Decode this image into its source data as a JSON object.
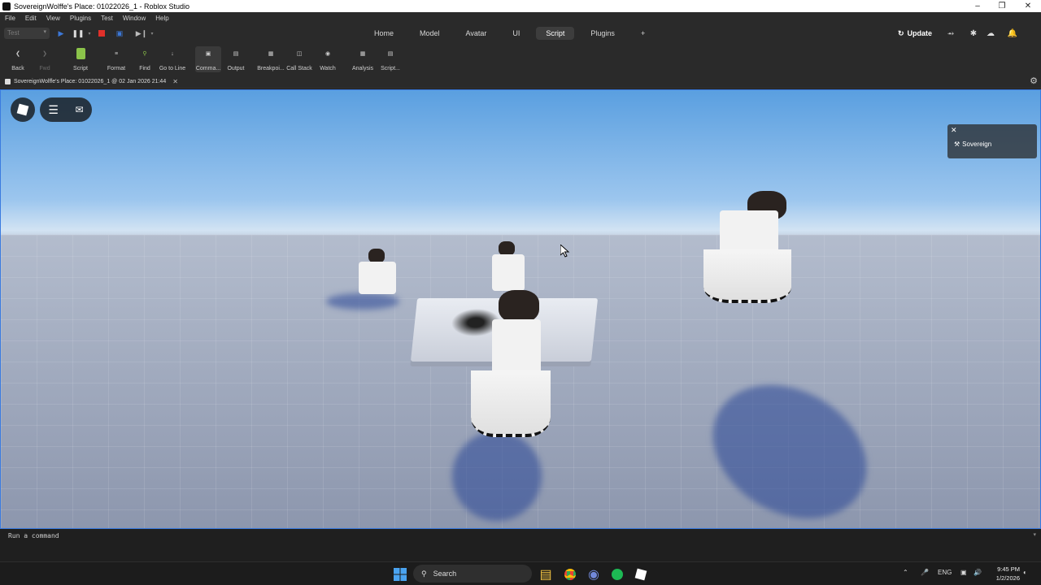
{
  "window": {
    "title": "SovereignWolffe's Place: 01022026_1 - Roblox Studio"
  },
  "menu": [
    "File",
    "Edit",
    "View",
    "Plugins",
    "Test",
    "Window",
    "Help"
  ],
  "toolbar_top": {
    "test_select": "Test",
    "tabs": [
      "Home",
      "Model",
      "Avatar",
      "UI",
      "Script",
      "Plugins",
      "+"
    ],
    "active_tab": "Script",
    "update_label": "Update"
  },
  "ribbon": {
    "items": [
      "Back",
      "Fwd",
      "Script",
      "Format",
      "Find",
      "Go to Line",
      "Comma...",
      "Output",
      "Breakpoi...",
      "Call Stack",
      "Watch",
      "Analysis",
      "Script..."
    ]
  },
  "document": {
    "tab_label": "SovereignWolffe's Place: 01022026_1 @ 02 Jan 2026 21:44"
  },
  "viewport": {
    "notification_user": "Sovereign"
  },
  "command_bar": {
    "placeholder": "Run a command"
  },
  "taskbar": {
    "search_label": "Search",
    "language": "ENG",
    "time": "9:45 PM",
    "date": "1/2/2026"
  },
  "colors": {
    "accent_viewport_border": "#3a7be0",
    "stop_red": "#e0302a",
    "play_blue": "#3c78d8"
  }
}
